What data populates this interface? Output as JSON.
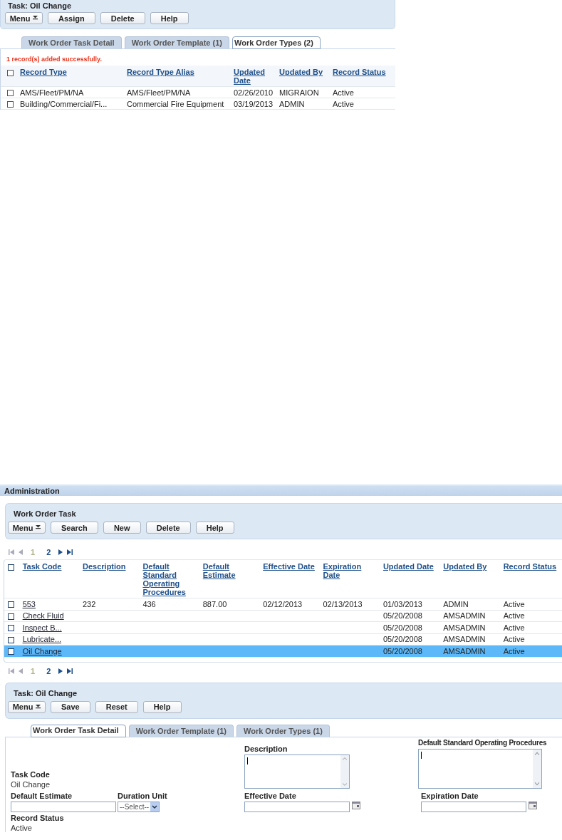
{
  "top_panel": {
    "title": "Task:  Oil Change",
    "buttons": [
      {
        "label": "Menu",
        "kind": "menu"
      },
      {
        "label": "Assign",
        "kind": "plain"
      },
      {
        "label": "Delete",
        "kind": "plain"
      },
      {
        "label": "Help",
        "kind": "plain"
      }
    ],
    "tabs": [
      {
        "label": "Work Order Task Detail",
        "selected": false
      },
      {
        "label": "Work Order Template (1)",
        "selected": false
      },
      {
        "label": "Work Order Types (2)",
        "selected": true
      }
    ],
    "message": "1 record(s) added successfully.",
    "table": {
      "header_checked": false,
      "columns": [
        "Record Type",
        "Record Type Alias",
        "Updated Date",
        "Updated By",
        "Record Status"
      ],
      "rows": [
        {
          "checked": false,
          "cells": [
            "AMS/Fleet/PM/NA",
            "AMS/Fleet/PM/NA",
            "02/26/2010",
            "MIGRAION",
            "Active"
          ]
        },
        {
          "checked": false,
          "cells": [
            "Building/Commercial/Fi...",
            "Commercial Fire Equipment",
            "03/19/2013",
            "ADMIN",
            "Active"
          ]
        }
      ]
    }
  },
  "section_title": "Administration",
  "list_panel": {
    "title": "Work Order Task",
    "buttons": [
      {
        "label": "Menu",
        "kind": "menu"
      },
      {
        "label": "Search",
        "kind": "plain"
      },
      {
        "label": "New",
        "kind": "plain"
      },
      {
        "label": "Delete",
        "kind": "plain"
      },
      {
        "label": "Help",
        "kind": "plain"
      }
    ],
    "pager": [
      {
        "label": "1",
        "selected": true
      },
      {
        "label": "2",
        "selected": false
      }
    ],
    "table": {
      "header_checked": false,
      "columns": [
        "Task Code",
        "Description",
        "Default Standard Operating Procedures",
        "Default Estimate",
        "Effective Date",
        "Expiration Date",
        "Updated Date",
        "Updated By",
        "Record Status"
      ],
      "rows": [
        {
          "checked": false,
          "selected": false,
          "cells": [
            "553",
            "232",
            "436",
            "887.00",
            "02/12/2013",
            "02/13/2013",
            "01/03/2013",
            "ADMIN",
            "Active"
          ]
        },
        {
          "checked": false,
          "selected": false,
          "cells": [
            "Check Fluid",
            "",
            "",
            "",
            "",
            "",
            "05/20/2008",
            "AMSADMIN",
            "Active"
          ]
        },
        {
          "checked": false,
          "selected": false,
          "cells": [
            "Inspect B...",
            "",
            "",
            "",
            "",
            "",
            "05/20/2008",
            "AMSADMIN",
            "Active"
          ]
        },
        {
          "checked": false,
          "selected": false,
          "cells": [
            "Lubricate...",
            "",
            "",
            "",
            "",
            "",
            "05/20/2008",
            "AMSADMIN",
            "Active"
          ]
        },
        {
          "checked": false,
          "selected": true,
          "cells": [
            "Oil Change",
            "",
            "",
            "",
            "",
            "",
            "05/20/2008",
            "AMSADMIN",
            "Active"
          ]
        }
      ]
    },
    "pager_bottom": [
      {
        "label": "1",
        "selected": true
      },
      {
        "label": "2",
        "selected": false
      }
    ]
  },
  "detail_panel": {
    "title": "Task: Oil Change",
    "buttons": [
      {
        "label": "Menu",
        "kind": "menu"
      },
      {
        "label": "Save",
        "kind": "plain"
      },
      {
        "label": "Reset",
        "kind": "plain"
      },
      {
        "label": "Help",
        "kind": "plain"
      }
    ],
    "tabs": [
      {
        "label": "Work Order Task Detail",
        "selected": true
      },
      {
        "label": "Work Order Template (1)",
        "selected": false
      },
      {
        "label": "Work Order Types (1)",
        "selected": false
      }
    ],
    "form_rows": [
      [
        {
          "kind": "text",
          "label": "Task Code",
          "value": "Oil Change"
        },
        {
          "kind": "textarea",
          "label": "Description"
        },
        {
          "kind": "textarea",
          "label": "Default Standard Operating Procedures"
        }
      ],
      [
        {
          "kind": "input",
          "label": "Default Estimate"
        },
        {
          "kind": "select",
          "label": "Duration Unit",
          "value": "--Select--"
        },
        {
          "kind": "date",
          "label": "Effective Date"
        },
        {
          "kind": "date",
          "label": "Expiration Date"
        }
      ],
      [
        {
          "kind": "text",
          "label": "Record Status",
          "value": "Active"
        }
      ]
    ]
  }
}
